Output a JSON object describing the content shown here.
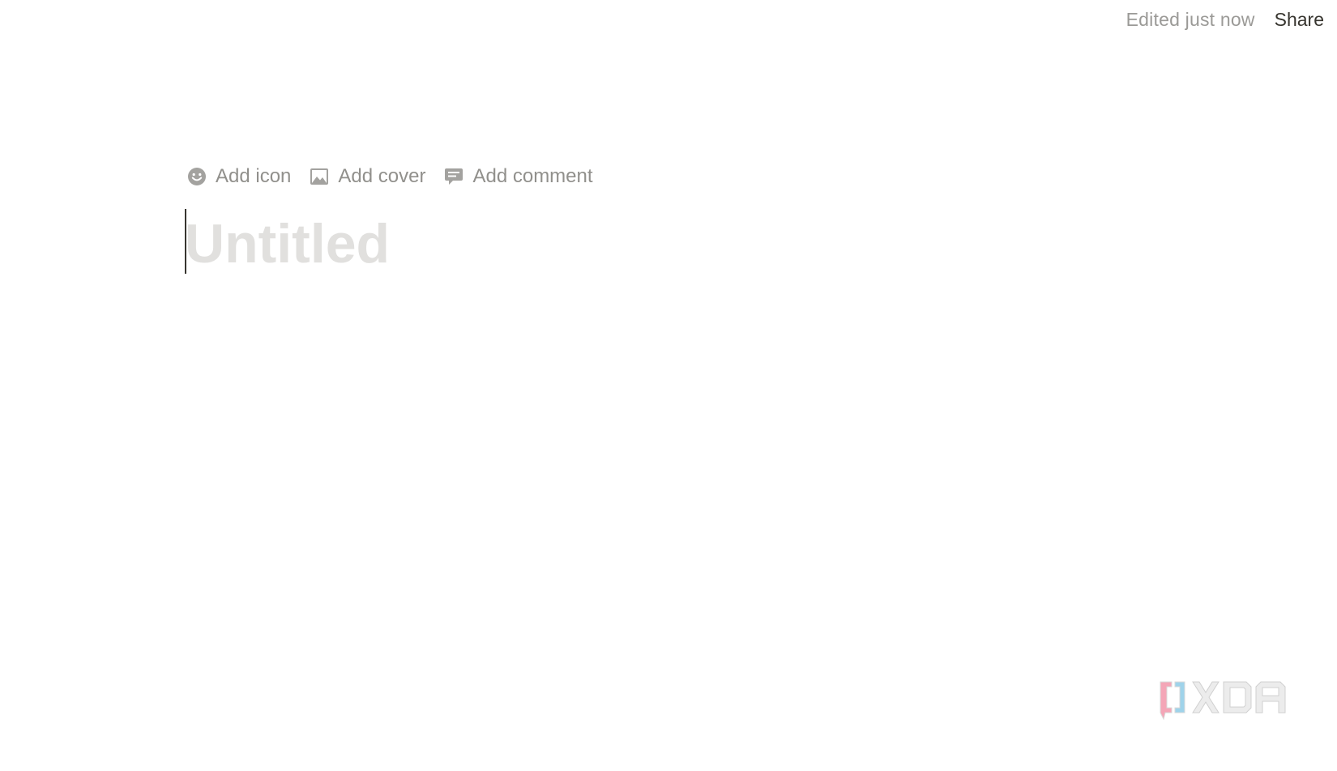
{
  "topbar": {
    "edited_status": "Edited just now",
    "share_label": "Share"
  },
  "page_controls": {
    "add_icon_label": "Add icon",
    "add_cover_label": "Add cover",
    "add_comment_label": "Add comment"
  },
  "title": {
    "placeholder": "Untitled",
    "value": ""
  },
  "watermark": {
    "text": "XDA",
    "colors": {
      "pink": "#f4a6b7",
      "blue": "#9fd3ea",
      "gray": "#ececec"
    }
  },
  "colors": {
    "muted_text": "#9b9a97",
    "primary_text": "#37352f",
    "icon_gray": "#a3a29f",
    "placeholder": "#e1e0de"
  },
  "icons": {
    "add_icon": "smile-face-icon",
    "add_cover": "image-icon",
    "add_comment": "comment-bubble-icon"
  }
}
